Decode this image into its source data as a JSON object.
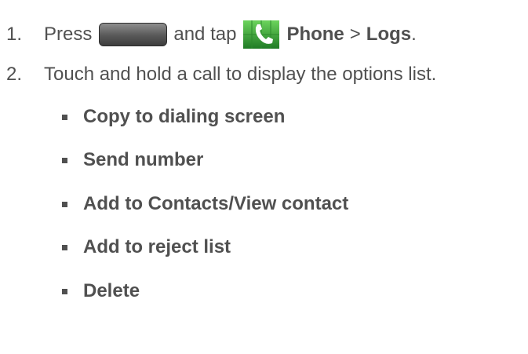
{
  "steps": [
    {
      "number": "1.",
      "press": "Press",
      "and_tap": "and tap",
      "phone": "Phone",
      "separator": ">",
      "logs": "Logs",
      "period": ".",
      "icons": [
        "home-button-icon",
        "phone-app-icon"
      ]
    },
    {
      "number": "2.",
      "text": "Touch and hold a call to display the options list."
    }
  ],
  "options": [
    "Copy to dialing screen",
    "Send number",
    "Add to Contacts/View contact",
    "Add to reject list",
    "Delete"
  ],
  "colors": {
    "text": "#505050",
    "icon_green": "#3fa83a"
  }
}
